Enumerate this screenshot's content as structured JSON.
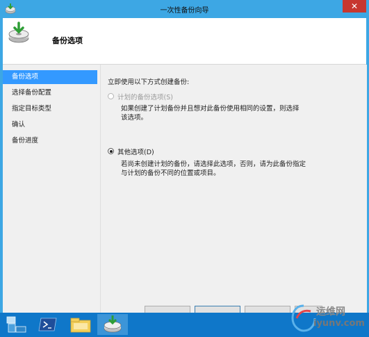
{
  "window": {
    "title": "一次性备份向导",
    "close_label": "✕"
  },
  "header": {
    "title": "备份选项"
  },
  "sidebar": {
    "items": [
      {
        "label": "备份选项",
        "active": true
      },
      {
        "label": "选择备份配置",
        "active": false
      },
      {
        "label": "指定目标类型",
        "active": false
      },
      {
        "label": "确认",
        "active": false
      },
      {
        "label": "备份进度",
        "active": false
      }
    ]
  },
  "main": {
    "prompt": "立即使用以下方式创建备份:",
    "options": [
      {
        "label": "计划的备份选项(S)",
        "selected": false,
        "disabled": true,
        "description_line1": "如果创建了计划备份并且想对此备份使用相同的设置，则选择",
        "description_line2": "该选项。"
      },
      {
        "label": "其他选项(D)",
        "selected": true,
        "disabled": false,
        "description_line1": "若尚未创建计划的备份，请选择此选项，否则，请为此备份指定",
        "description_line2": "与计划的备份不同的位置或项目。"
      }
    ]
  },
  "taskbar": {
    "items": [
      "server-manager-icon",
      "powershell-icon",
      "file-explorer-icon",
      "backup-wizard-icon"
    ]
  },
  "watermark": {
    "line1": "运维网",
    "line2": "iyunv.com"
  },
  "colors": {
    "titlebar": "#3da7e4",
    "taskbar": "#0f77c9",
    "selection": "#3399ff",
    "close": "#c7372f"
  }
}
